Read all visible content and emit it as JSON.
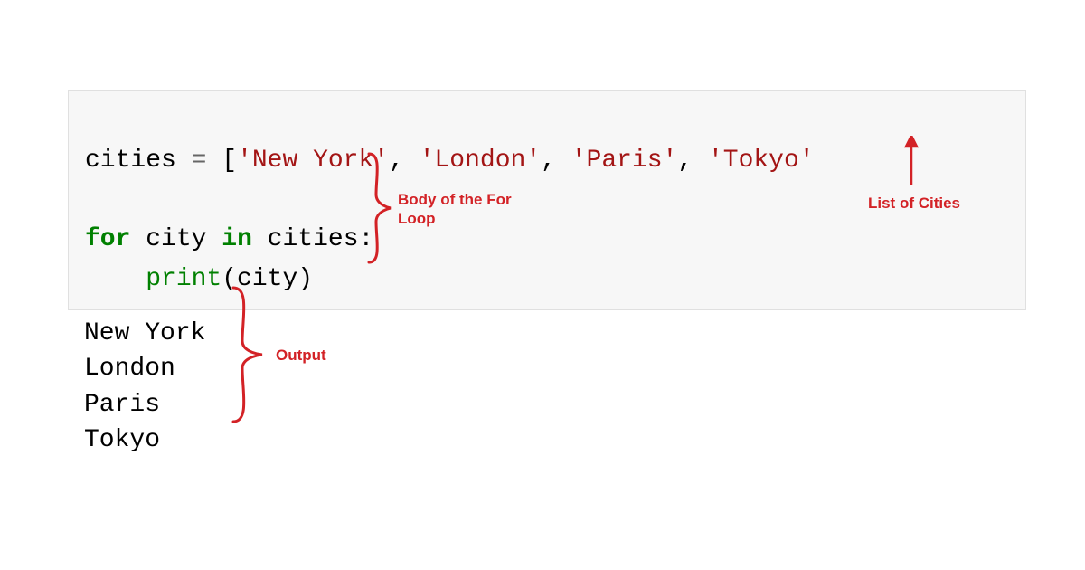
{
  "code": {
    "line1": {
      "var": "cities",
      "op": " = ",
      "bracket_open": "[",
      "s1": "'New York'",
      "c1": ", ",
      "s2": "'London'",
      "c2": ", ",
      "s3": "'Paris'",
      "c3": ", ",
      "s4": "'Tokyo'"
    },
    "blank": "",
    "line2": {
      "kw_for": "for",
      "sp1": " ",
      "var_city": "city",
      "sp2": " ",
      "kw_in": "in",
      "sp3": " ",
      "var_cities": "cities",
      "colon": ":"
    },
    "line3": {
      "indent": "    ",
      "func": "print",
      "paren_open": "(",
      "arg": "city",
      "paren_close": ")"
    }
  },
  "output": {
    "line1": "New York",
    "line2": "London",
    "line3": "Paris",
    "line4": "Tokyo"
  },
  "annotations": {
    "body_label": "Body of the For Loop",
    "list_label": "List of Cities",
    "output_label": "Output"
  }
}
